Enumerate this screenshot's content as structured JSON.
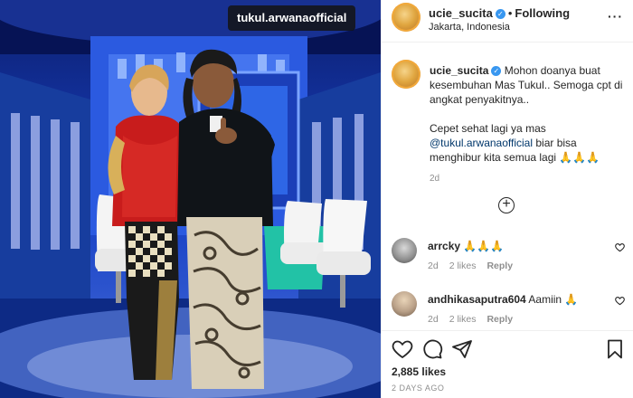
{
  "photo": {
    "tag": "tukul.arwanaofficial"
  },
  "post": {
    "username": "ucie_sucita",
    "verified_mark": "✓",
    "dot": "•",
    "follow_label": "Following",
    "location": "Jakarta, Indonesia",
    "more_label": "···"
  },
  "caption": {
    "username": "ucie_sucita",
    "line1": "Mohon doanya buat kesembuhan Mas Tukul.. Semoga cpt di angkat penyakitnya..",
    "line2_pre": "Cepet sehat lagi ya mas",
    "mention": "@tukul.arwanaofficial",
    "line2_post": "biar bisa menghibur kita semua lagi 🙏🙏🙏",
    "time": "2d"
  },
  "load_more": "+",
  "comments": [
    {
      "username": "arrcky",
      "text": "🙏🙏🙏",
      "time": "2d",
      "likes": "2 likes",
      "reply": "Reply"
    },
    {
      "username": "andhikasaputra604",
      "text": "Aamiin 🙏",
      "time": "2d",
      "likes": "2 likes",
      "reply": "Reply"
    }
  ],
  "likes_count": "2,885 likes",
  "date": "2 DAYS AGO",
  "icons": [
    "heart-icon",
    "comment-icon",
    "share-icon",
    "bookmark-icon",
    "plus-circle-icon"
  ]
}
